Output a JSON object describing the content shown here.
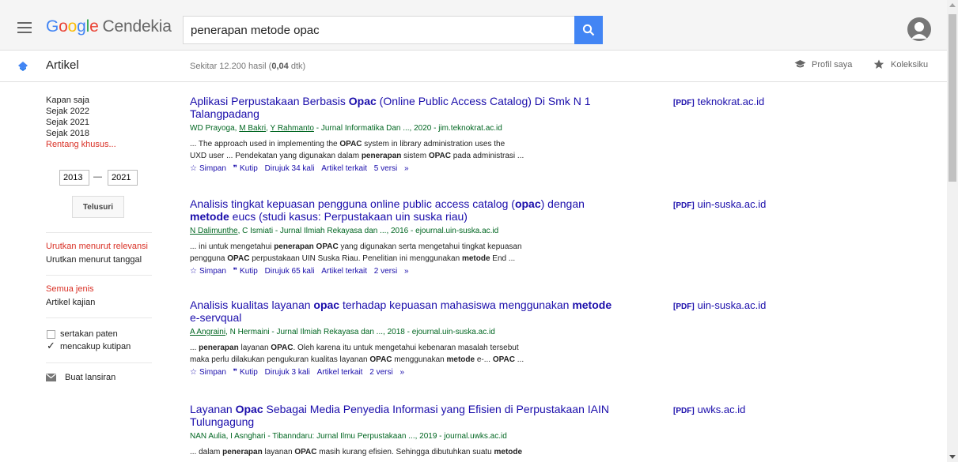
{
  "header": {
    "logo_google": "Google",
    "logo_product": "Cendekia",
    "search_value": "penerapan metode opac"
  },
  "subbar": {
    "section_label": "Artikel",
    "result_count_prefix": "Sekitar 12.200 hasil (",
    "result_time": "0,04",
    "result_count_suffix": " dtk)",
    "profile_label": "Profil saya",
    "library_label": "Koleksiku"
  },
  "sidebar": {
    "time_filters": [
      "Kapan saja",
      "Sejak 2022",
      "Sejak 2021",
      "Sejak 2018",
      "Rentang khusus..."
    ],
    "year_from": "2013",
    "year_dash": "—",
    "year_to": "2021",
    "search_button": "Telusuri",
    "sort_relevance": "Urutkan menurut relevansi",
    "sort_date": "Urutkan menurut tanggal",
    "type_all": "Semua jenis",
    "type_review": "Artikel kajian",
    "include_patents": "sertakan paten",
    "include_citations": "mencakup kutipan",
    "create_alert": "Buat lansiran"
  },
  "results": [
    {
      "title_html": "Aplikasi Perpustakaan Berbasis <b>Opac</b> (Online Public Access Catalog) Di Smk N 1 Talangpadang",
      "meta_html": "WD Prayoga, <u>M Bakri</u>, <u>Y Rahmanto</u> - Jurnal Informatika Dan ..., 2020 - jim.teknokrat.ac.id",
      "snippet1_html": "... The approach used in implementing the <b>OPAC</b> system in library administration uses the",
      "snippet2_html": "UXD user ... Pendekatan yang digunakan dalam <b>penerapan</b> sistem <b>OPAC</b> pada administrasi ...",
      "save": "Simpan",
      "cite": "Kutip",
      "cited_by": "Dirujuk 34 kali",
      "related": "Artikel terkait",
      "versions": "5 versi",
      "pdf_tag": "[PDF]",
      "pdf_domain": "teknokrat.ac.id"
    },
    {
      "title_html": "Analisis tingkat kepuasan pengguna online public access catalog (<b>opac</b>) dengan <b>metode</b> eucs (studi kasus: Perpustakaan uin suska riau)",
      "meta_html": "<u>N Dalimunthe</u>, C Ismiati - Jurnal Ilmiah Rekayasa dan ..., 2016 - ejournal.uin-suska.ac.id",
      "snippet1_html": "... ini untuk mengetahui <b>penerapan</b> <b>OPAC</b> yang digunakan serta mengetahui tingkat kepuasan",
      "snippet2_html": "pengguna <b>OPAC</b> perpustakaan UIN Suska Riau. Penelitian ini menggunakan <b>metode</b> End ...",
      "save": "Simpan",
      "cite": "Kutip",
      "cited_by": "Dirujuk 65 kali",
      "related": "Artikel terkait",
      "versions": "2 versi",
      "pdf_tag": "[PDF]",
      "pdf_domain": "uin-suska.ac.id"
    },
    {
      "title_html": "Analisis kualitas layanan <b>opac</b> terhadap kepuasan mahasiswa menggunakan <b>metode</b> e-servqual",
      "meta_html": "<u>A Angraini</u>, N Hermaini - Jurnal Ilmiah Rekayasa dan ..., 2018 - ejournal.uin-suska.ac.id",
      "snippet1_html": "... <b>penerapan</b> layanan <b>OPAC</b>. Oleh karena itu untuk mengetahui kebenaran masalah tersebut",
      "snippet2_html": "maka perlu dilakukan pengukuran kualitas layanan <b>OPAC</b> menggunakan <b>metode</b> e-... <b>OPAC</b> ...",
      "save": "Simpan",
      "cite": "Kutip",
      "cited_by": "Dirujuk 3 kali",
      "related": "Artikel terkait",
      "versions": "2 versi",
      "pdf_tag": "[PDF]",
      "pdf_domain": "uin-suska.ac.id"
    },
    {
      "title_html": "Layanan <b>Opac</b> Sebagai Media Penyedia Informasi yang Efisien di Perpustakaan IAIN Tulungagung",
      "meta_html": "NAN Aulia, I Asnghari - Tibanndaru: Jurnal Ilmu Perpustakaan ..., 2019 - journal.uwks.ac.id",
      "snippet1_html": "... dalam <b>penerapan</b> layanan <b>OPAC</b> masih kurang efisien. Sehingga dibutuhkan suatu <b>metode</b>",
      "snippet2_html": "",
      "save": "",
      "cite": "",
      "cited_by": "",
      "related": "",
      "versions": "",
      "pdf_tag": "[PDF]",
      "pdf_domain": "uwks.ac.id"
    }
  ]
}
